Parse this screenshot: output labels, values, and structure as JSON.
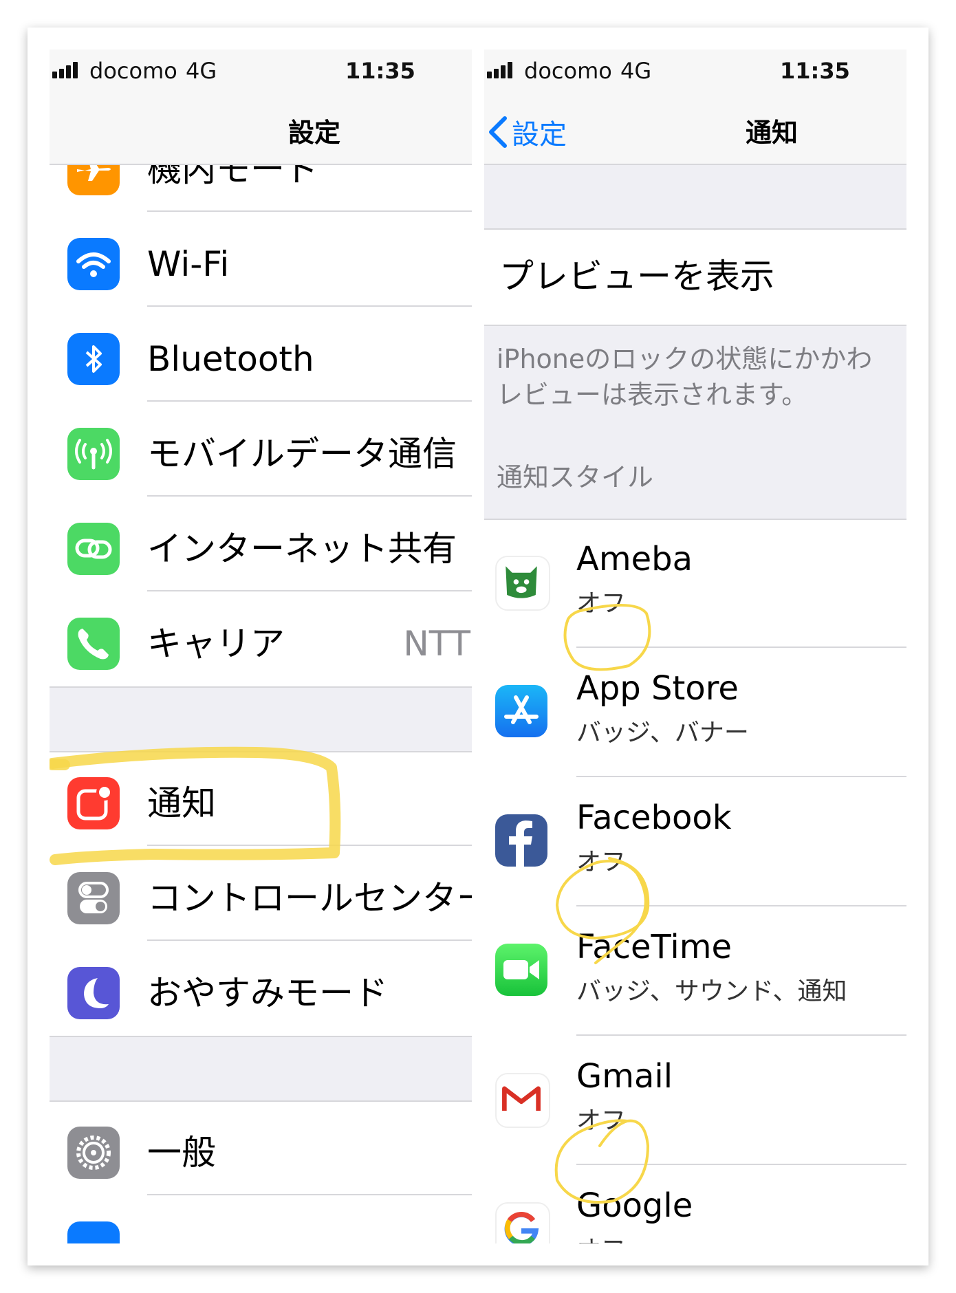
{
  "left": {
    "status": {
      "carrier": "docomo",
      "network": "4G",
      "time": "11:35"
    },
    "nav_title": "設定",
    "rows": [
      {
        "label": "機内モード",
        "icon": "airplane-icon",
        "color": "#ff9500"
      },
      {
        "label": "Wi-Fi",
        "icon": "wifi-icon",
        "color": "#0a7aff"
      },
      {
        "label": "Bluetooth",
        "icon": "bluetooth-icon",
        "color": "#0a7aff"
      },
      {
        "label": "モバイルデータ通信",
        "icon": "antenna-icon",
        "color": "#4cd964"
      },
      {
        "label": "インターネット共有",
        "icon": "link-icon",
        "color": "#4cd964"
      },
      {
        "label": "キャリア",
        "detail": "NTT",
        "icon": "phone-icon",
        "color": "#4cd964"
      },
      {
        "label": "通知",
        "icon": "notification-icon",
        "color": "#ff3b30"
      },
      {
        "label": "コントロールセンター",
        "icon": "toggle-icon",
        "color": "#8e8e93"
      },
      {
        "label": "おやすみモード",
        "icon": "moon-icon",
        "color": "#5856d6"
      },
      {
        "label": "一般",
        "icon": "gear-icon",
        "color": "#8e8e93"
      }
    ]
  },
  "right": {
    "status": {
      "carrier": "docomo",
      "network": "4G",
      "time": "11:35"
    },
    "back_label": "設定",
    "nav_title": "通知",
    "preview_label": "プレビューを表示",
    "preview_note_line1": "iPhoneのロックの状態にかかわ",
    "preview_note_line2": "レビューは表示されます。",
    "section_header": "通知スタイル",
    "apps": [
      {
        "name": "Ameba",
        "sub": "オフ",
        "icon": "ameba-icon"
      },
      {
        "name": "App Store",
        "sub": "バッジ、バナー",
        "icon": "app-store-icon"
      },
      {
        "name": "Facebook",
        "sub": "オフ",
        "icon": "facebook-icon"
      },
      {
        "name": "FaceTime",
        "sub": "バッジ、サウンド、通知",
        "icon": "facetime-icon"
      },
      {
        "name": "Gmail",
        "sub": "オフ",
        "icon": "gmail-icon"
      },
      {
        "name": "Google",
        "sub": "オフ",
        "icon": "google-icon"
      }
    ]
  },
  "colors": {
    "accent": "#0a7aff",
    "highlight": "#f7d74a",
    "separator": "#d7d7db",
    "grouped_bg": "#efeff4"
  }
}
